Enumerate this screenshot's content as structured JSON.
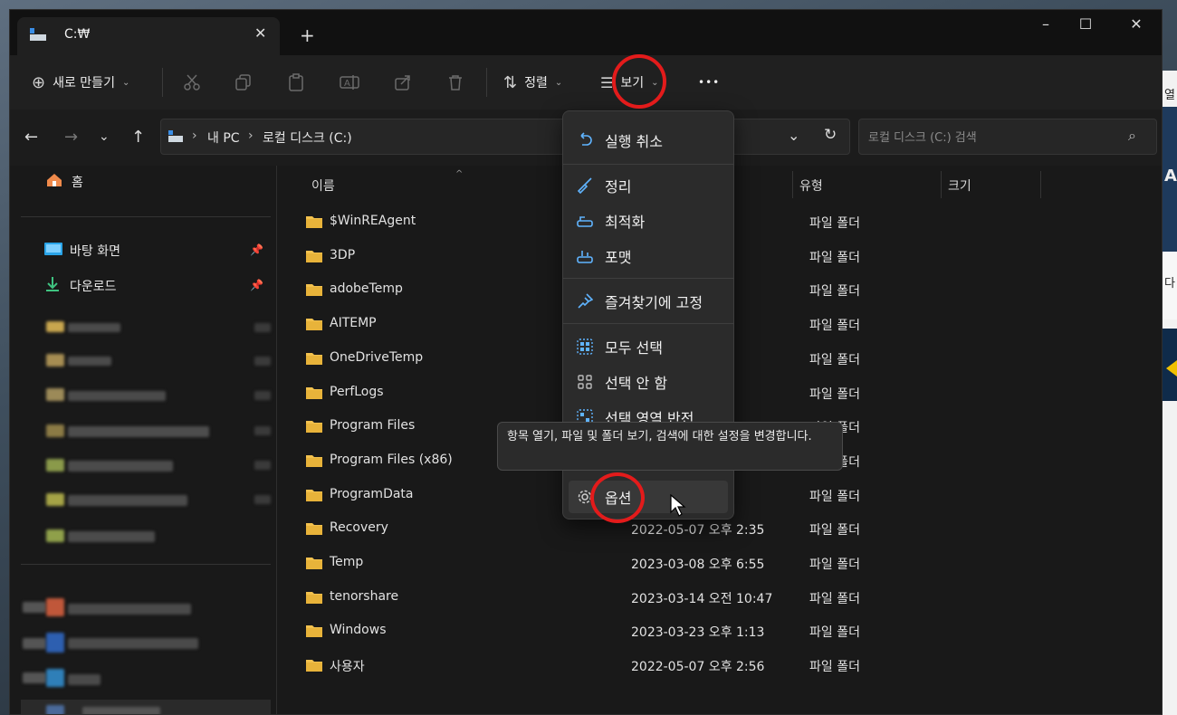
{
  "window": {
    "tab_title": "C:₩",
    "new_tab": "+",
    "controls": {
      "minimize": "–",
      "maximize": "☐",
      "close": "✕"
    }
  },
  "toolbar": {
    "new_label": "새로 만들기",
    "sort_label": "정렬",
    "view_label": "보기",
    "more_label": "•••",
    "icons": [
      "cut-icon",
      "copy-icon",
      "paste-icon",
      "rename-icon",
      "share-icon",
      "delete-icon"
    ]
  },
  "address": {
    "crumbs": [
      "내 PC",
      "로컬 디스크 (C:)"
    ],
    "separator": "›"
  },
  "search": {
    "placeholder": "로컬 디스크 (C:) 검색"
  },
  "sidebar": {
    "home": "홈",
    "items": [
      {
        "label": "바탕 화면",
        "pinned": true
      },
      {
        "label": "다운로드",
        "pinned": true
      }
    ]
  },
  "columns": {
    "name": "이름",
    "type": "유형",
    "size": "크기"
  },
  "files": [
    {
      "name": "$WinREAgent",
      "date": "22",
      "type": "파일 폴더"
    },
    {
      "name": "3DP",
      "date": "0:47",
      "type": "파일 폴더"
    },
    {
      "name": "adobeTemp",
      "date": "18",
      "type": "파일 폴더"
    },
    {
      "name": "AITEMP",
      "date": "21",
      "type": "파일 폴더"
    },
    {
      "name": "OneDriveTemp",
      "date": "50",
      "type": "파일 폴더"
    },
    {
      "name": "PerfLogs",
      "date": "24",
      "type": "파일 폴더"
    },
    {
      "name": "Program Files",
      "date": "34",
      "type": "파일 폴더"
    },
    {
      "name": "Program Files (x86)",
      "date": "",
      "type": "파일 폴더"
    },
    {
      "name": "ProgramData",
      "date": "0:43",
      "type": "파일 폴더"
    },
    {
      "name": "Recovery",
      "date": "2022-05-07 오후 2:35",
      "type": "파일 폴더"
    },
    {
      "name": "Temp",
      "date": "2023-03-08 오후 6:55",
      "type": "파일 폴더"
    },
    {
      "name": "tenorshare",
      "date": "2023-03-14 오전 10:47",
      "type": "파일 폴더"
    },
    {
      "name": "Windows",
      "date": "2023-03-23 오후 1:13",
      "type": "파일 폴더"
    },
    {
      "name": "사용자",
      "date": "2022-05-07 오후 2:56",
      "type": "파일 폴더"
    }
  ],
  "view_menu": {
    "items": [
      {
        "label": "실행 취소",
        "icon": "undo-icon"
      },
      {
        "label": "정리",
        "icon": "broom-icon"
      },
      {
        "label": "최적화",
        "icon": "optimize-drive-icon"
      },
      {
        "label": "포맷",
        "icon": "format-drive-icon"
      },
      {
        "label": "즐겨찾기에 고정",
        "icon": "pin-icon"
      },
      {
        "label": "모두 선택",
        "icon": "select-all-icon"
      },
      {
        "label": "선택 안 함",
        "icon": "select-none-icon"
      },
      {
        "label": "선택 영역 반전",
        "icon": "invert-selection-icon"
      },
      {
        "label": "옵션",
        "icon": "gear-icon"
      }
    ],
    "tooltip": "항목 열기, 파일 및 폴더 보기, 검색에 대한 설정을 변경합니다."
  },
  "background": {
    "right_edge_texts": [
      "열",
      "A",
      "다"
    ]
  },
  "colors": {
    "accent": "#60b4ff",
    "highlight_ring": "#e31b1b",
    "folder": "#f2c14e"
  }
}
